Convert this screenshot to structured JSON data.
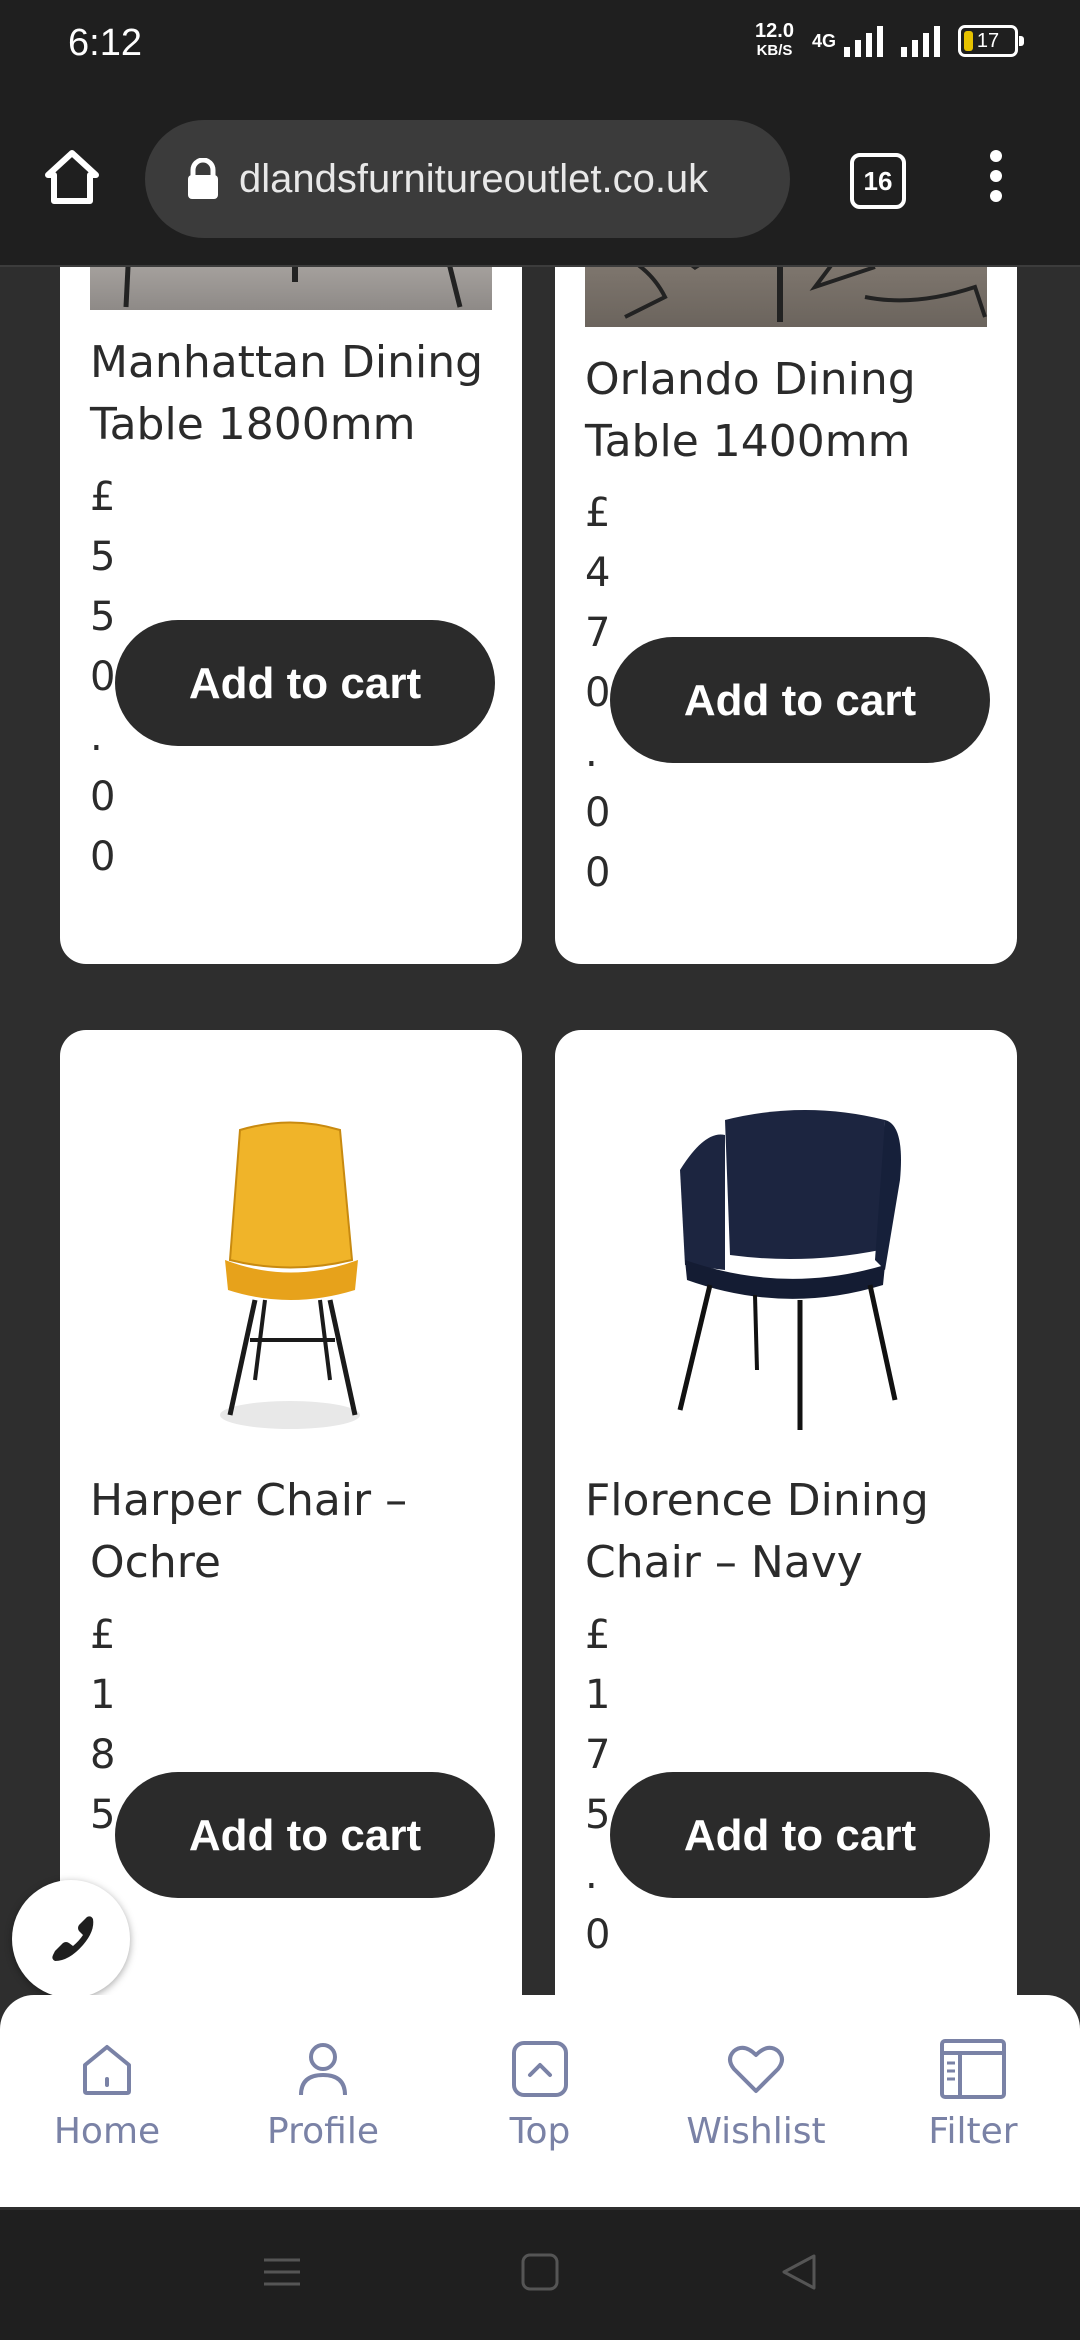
{
  "status_bar": {
    "time": "6:12",
    "net_speed_value": "12.0",
    "net_speed_unit": "KB/S",
    "network": "4G",
    "battery": "17"
  },
  "browser": {
    "url": "dlandsfurnitureoutlet.co.uk",
    "tab_count": "16"
  },
  "products": [
    {
      "title_line1": "Manhattan Dining",
      "title_line2": "Table 1800mm",
      "price_chars": [
        "£",
        "5",
        "5",
        "0",
        ".",
        "0",
        "0"
      ],
      "button_label": "Add to cart"
    },
    {
      "title_line1": "Orlando Dining",
      "title_line2": "Table 1400mm",
      "price_chars": [
        "£",
        "4",
        "7",
        "0",
        ".",
        "0",
        "0"
      ],
      "button_label": "Add to cart"
    },
    {
      "title_line1": "Harper Chair –",
      "title_line2": "Ochre",
      "price_chars": [
        "£",
        "1",
        "8",
        "5"
      ],
      "button_label": "Add to cart",
      "image_color": "#f0b429"
    },
    {
      "title_line1": "Florence Dining",
      "title_line2": "Chair – Navy",
      "price_chars": [
        "£",
        "1",
        "7",
        "5",
        ".",
        "0"
      ],
      "button_label": "Add to cart",
      "image_color": "#1c2540"
    }
  ],
  "bottom_nav": [
    {
      "label": "Home",
      "icon": "home-icon"
    },
    {
      "label": "Profile",
      "icon": "profile-icon"
    },
    {
      "label": "Top",
      "icon": "scroll-top-icon"
    },
    {
      "label": "Wishlist",
      "icon": "heart-icon"
    },
    {
      "label": "Filter",
      "icon": "filter-icon"
    }
  ],
  "colors": {
    "accent": "#2b2b2b",
    "nav_icon": "#7a82a6",
    "page_background": "#2e2e2e"
  }
}
